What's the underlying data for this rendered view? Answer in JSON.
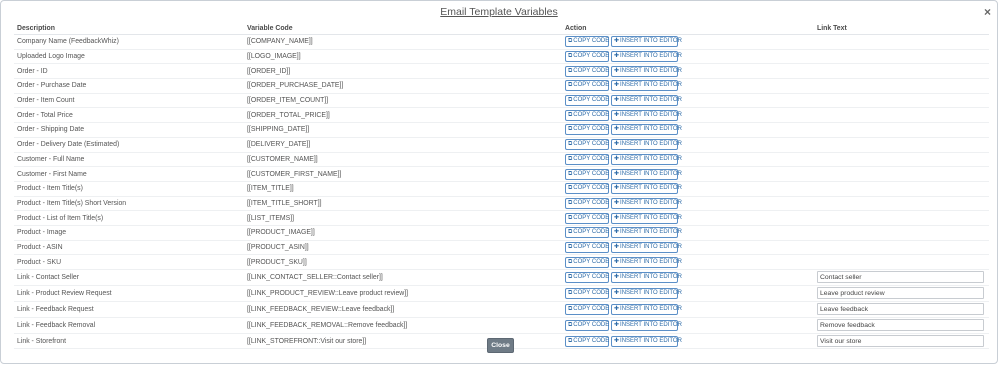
{
  "modal": {
    "title": "Email Template Variables",
    "close_icon": "×",
    "close_button": "Close"
  },
  "table": {
    "headers": {
      "description": "Description",
      "variable": "Variable Code",
      "action": "Action",
      "link_text": "Link Text"
    },
    "copy_label": "COPY CODE",
    "insert_label": "INSERT INTO EDITOR",
    "copy_icon": "copy-icon",
    "insert_icon": "plus-icon",
    "rows": [
      {
        "description": "Company Name (FeedbackWhiz)",
        "variable": "[[COMPANY_NAME]]"
      },
      {
        "description": "Uploaded Logo Image",
        "variable": "[[LOGO_IMAGE]]"
      },
      {
        "description": "Order - ID",
        "variable": "[[ORDER_ID]]"
      },
      {
        "description": "Order - Purchase Date",
        "variable": "[[ORDER_PURCHASE_DATE]]"
      },
      {
        "description": "Order - Item Count",
        "variable": "[[ORDER_ITEM_COUNT]]"
      },
      {
        "description": "Order - Total Price",
        "variable": "[[ORDER_TOTAL_PRICE]]"
      },
      {
        "description": "Order - Shipping Date",
        "variable": "[[SHIPPING_DATE]]"
      },
      {
        "description": "Order - Delivery Date (Estimated)",
        "variable": "[[DELIVERY_DATE]]"
      },
      {
        "description": "Customer - Full Name",
        "variable": "[[CUSTOMER_NAME]]"
      },
      {
        "description": "Customer - First Name",
        "variable": "[[CUSTOMER_FIRST_NAME]]"
      },
      {
        "description": "Product - Item Title(s)",
        "variable": "[[ITEM_TITLE]]"
      },
      {
        "description": "Product - Item Title(s) Short Version",
        "variable": "[[ITEM_TITLE_SHORT]]"
      },
      {
        "description": "Product - List of Item Title(s)",
        "variable": "[[LIST_ITEMS]]"
      },
      {
        "description": "Product - Image",
        "variable": "[[PRODUCT_IMAGE]]"
      },
      {
        "description": "Product - ASIN",
        "variable": "[[PRODUCT_ASIN]]"
      },
      {
        "description": "Product - SKU",
        "variable": "[[PRODUCT_SKU]]"
      }
    ],
    "link_rows": [
      {
        "description": "Link - Contact Seller",
        "variable": "[[LINK_CONTACT_SELLER::Contact seller]]",
        "link_text": "Contact seller"
      },
      {
        "description": "Link - Product Review Request",
        "variable": "[[LINK_PRODUCT_REVIEW::Leave product review]]",
        "link_text": "Leave product review"
      },
      {
        "description": "Link - Feedback Request",
        "variable": "[[LINK_FEEDBACK_REVIEW::Leave feedback]]",
        "link_text": "Leave feedback"
      },
      {
        "description": "Link - Feedback Removal",
        "variable": "[[LINK_FEEDBACK_REMOVAL::Remove feedback]]",
        "link_text": "Remove feedback"
      },
      {
        "description": "Link - Storefront",
        "variable": "[[LINK_STOREFRONT::Visit our store]]",
        "link_text": "Visit our store"
      }
    ]
  }
}
